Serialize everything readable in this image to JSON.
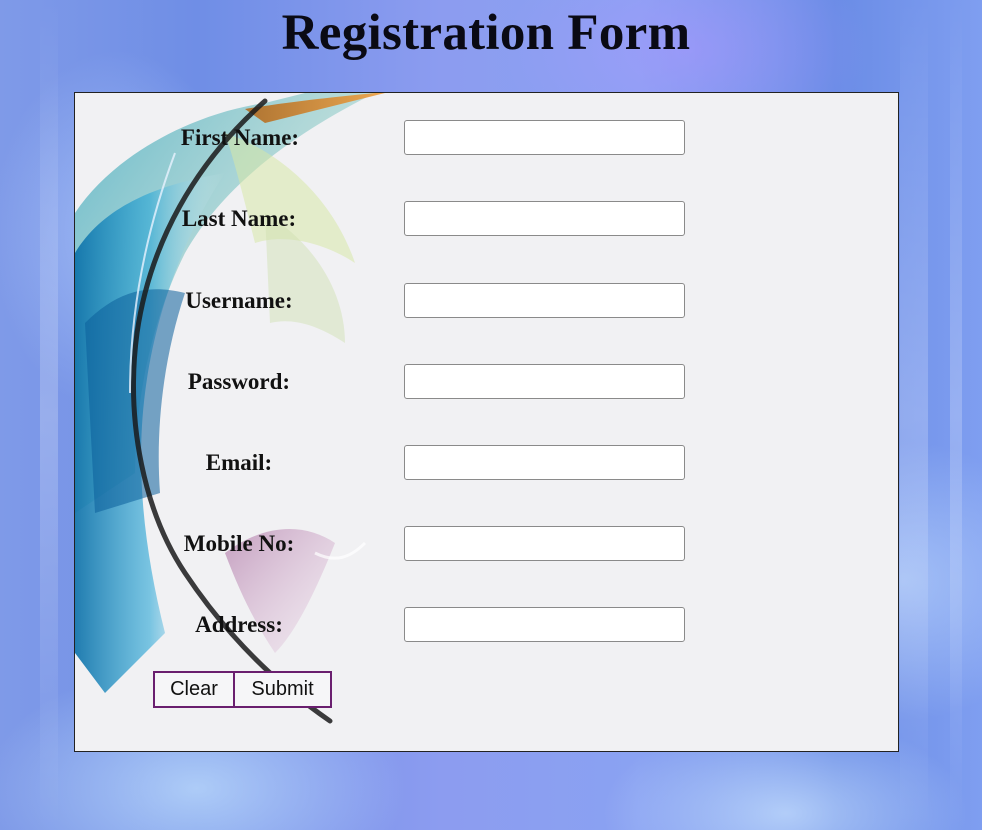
{
  "page": {
    "title": "Registration Form"
  },
  "form": {
    "fields": [
      {
        "id": "first-name",
        "label": "First Name:",
        "value": "",
        "placeholder": ""
      },
      {
        "id": "last-name",
        "label": "Last Name:",
        "value": "",
        "placeholder": ""
      },
      {
        "id": "username",
        "label": "Username:",
        "value": "",
        "placeholder": ""
      },
      {
        "id": "password",
        "label": "Password:",
        "value": "",
        "placeholder": ""
      },
      {
        "id": "email",
        "label": "Email:",
        "value": "",
        "placeholder": ""
      },
      {
        "id": "mobile-no",
        "label": "Mobile No:",
        "value": "",
        "placeholder": ""
      },
      {
        "id": "address",
        "label": "Address:",
        "value": "",
        "placeholder": ""
      }
    ],
    "buttons": {
      "clear_label": "Clear",
      "submit_label": "Submit"
    }
  },
  "colors": {
    "button_border": "#6a1f6f",
    "panel_background": "#f1f1f3",
    "page_background": "#8c9cf0"
  }
}
